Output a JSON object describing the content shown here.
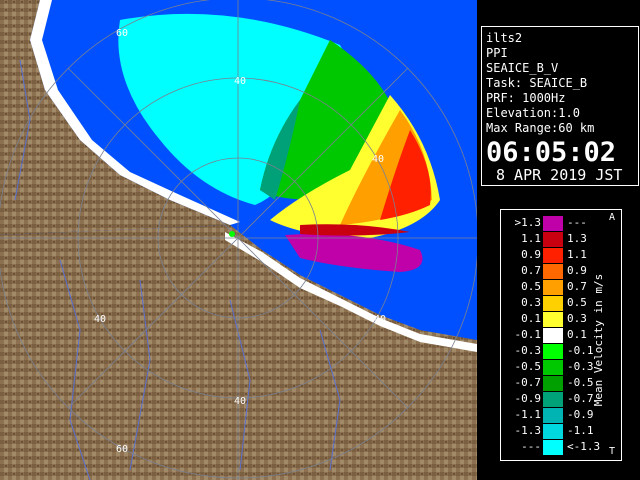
{
  "info": {
    "station": "ilts2",
    "scan_type": "PPI",
    "product": "SEAICE_B_V",
    "task": "Task: SEAICE_B",
    "prf": "PRF: 1000Hz",
    "elevation": "Elevation:1.0",
    "max_range": "Max Range:60 km",
    "time": "06:05:02",
    "date": "8 APR 2019 JST"
  },
  "legend": {
    "title": "Mean Velocity in m/s",
    "bins": [
      {
        "low": ">1.3",
        "high": "---",
        "color": "#c000a8"
      },
      {
        "low": "1.1",
        "high": "1.3",
        "color": "#c80010"
      },
      {
        "low": "0.9",
        "high": "1.1",
        "color": "#ff2000"
      },
      {
        "low": "0.7",
        "high": "0.9",
        "color": "#ff6800"
      },
      {
        "low": "0.5",
        "high": "0.7",
        "color": "#ffa000"
      },
      {
        "low": "0.3",
        "high": "0.5",
        "color": "#ffd000"
      },
      {
        "low": "0.1",
        "high": "0.3",
        "color": "#ffff30"
      },
      {
        "low": "-0.1",
        "high": "0.1",
        "color": "#ffffff"
      },
      {
        "low": "-0.3",
        "high": "-0.1",
        "color": "#00ff00"
      },
      {
        "low": "-0.5",
        "high": "-0.3",
        "color": "#00c800"
      },
      {
        "low": "-0.7",
        "high": "-0.5",
        "color": "#00a000"
      },
      {
        "low": "-0.9",
        "high": "-0.7",
        "color": "#00a078"
      },
      {
        "low": "-1.1",
        "high": "-0.9",
        "color": "#00b4b4"
      },
      {
        "low": "-1.3",
        "high": "-1.1",
        "color": "#00d8e0"
      },
      {
        "low": "---",
        "high": "<-1.3",
        "color": "#00ffff"
      }
    ]
  },
  "map": {
    "range_labels": [
      "60",
      "40",
      "40",
      "40",
      "40",
      "60",
      "60"
    ],
    "colors": {
      "sea": "#0050ff",
      "land": "#8c7050",
      "ice": "#ffffff"
    }
  }
}
